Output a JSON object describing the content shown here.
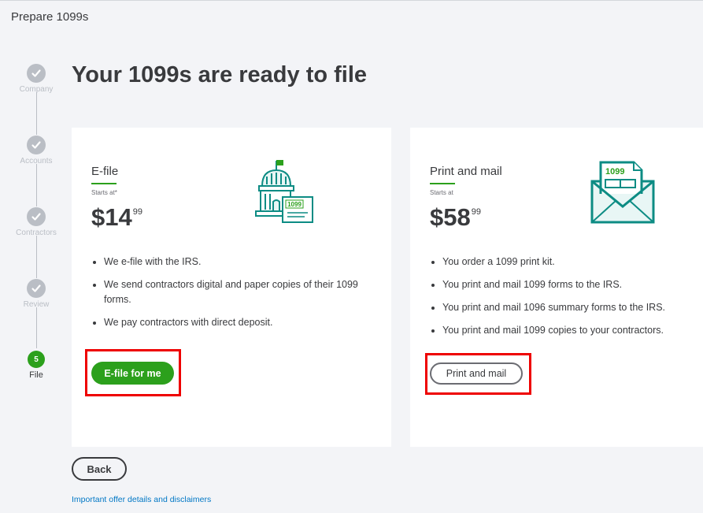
{
  "window": {
    "title": "Prepare 1099s"
  },
  "stepper": {
    "steps": [
      {
        "label": "Company",
        "state": "done"
      },
      {
        "label": "Accounts",
        "state": "done"
      },
      {
        "label": "Contractors",
        "state": "done"
      },
      {
        "label": "Review",
        "state": "done"
      },
      {
        "label": "File",
        "number": "5",
        "state": "active"
      }
    ]
  },
  "main": {
    "heading": "Your 1099s are ready to file",
    "efile": {
      "title": "E-file",
      "starts_at": "Starts at*",
      "price_main": "$14",
      "price_cents": "99",
      "bullets": [
        "We e-file with the IRS.",
        "We send contractors digital and paper copies of their 1099 forms.",
        "We pay contractors with direct deposit."
      ],
      "button_label": "E-file for me",
      "illustration_label": "1099"
    },
    "print": {
      "title": "Print and mail",
      "starts_at": "Starts at",
      "price_main": "$58",
      "price_cents": "99",
      "bullets": [
        "You order a 1099 print kit.",
        "You print and mail 1099 forms to the IRS.",
        "You print and mail 1096 summary forms to the IRS.",
        "You print and mail 1099 copies to your contractors."
      ],
      "button_label": "Print and mail",
      "illustration_label": "1099"
    },
    "back_label": "Back",
    "disclaimer_link": "Important offer details and disclaimers"
  },
  "colors": {
    "accent_green": "#2ca01c",
    "illustration_teal": "#0d8c84",
    "highlight_red": "#e00000",
    "link_blue": "#0077c5"
  }
}
